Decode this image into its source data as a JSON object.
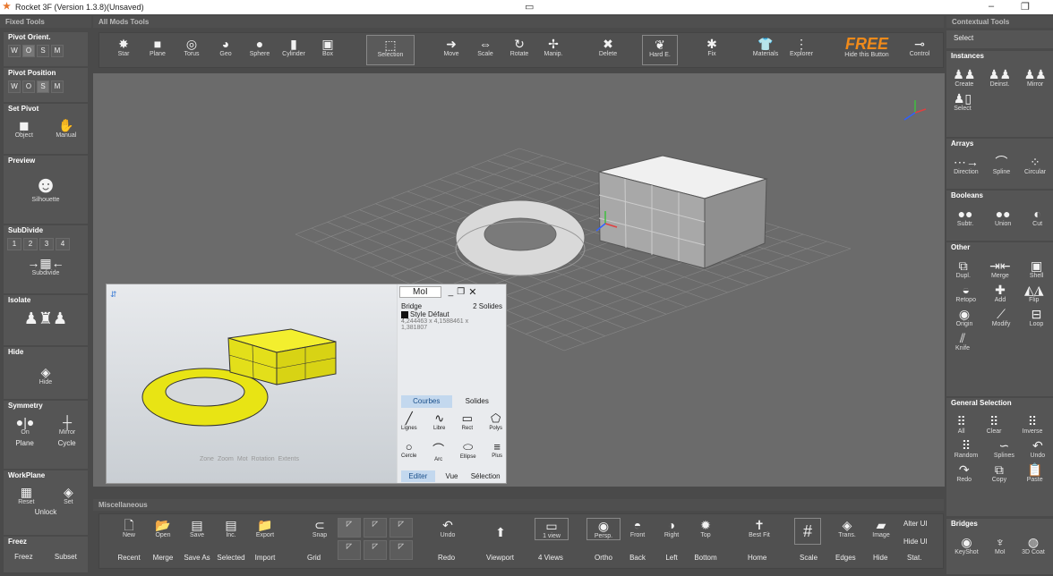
{
  "window": {
    "title": "Rocket 3F (Version 1.3.8)(Unsaved)"
  },
  "sections": {
    "fixed_tools": "Fixed Tools",
    "all_mods_tools": "All Mods Tools",
    "contextual_tools": "Contextual Tools",
    "miscellaneous": "Miscellaneous"
  },
  "left": {
    "pivot_orient": {
      "title": "Pivot Orient.",
      "opts": [
        "W",
        "O",
        "S",
        "M"
      ]
    },
    "pivot_position": {
      "title": "Pivot Position",
      "opts": [
        "W",
        "O",
        "S",
        "M"
      ]
    },
    "set_pivot": {
      "title": "Set Pivot",
      "object": "Object",
      "manual": "Manual"
    },
    "preview": {
      "title": "Preview",
      "silhouette": "Silhouette"
    },
    "subdivide": {
      "title": "SubDivide",
      "levels": [
        "1",
        "2",
        "3",
        "4"
      ],
      "button": "Subdivide"
    },
    "isolate": {
      "title": "Isolate"
    },
    "hide": {
      "title": "Hide",
      "button": "Hide"
    },
    "symmetry": {
      "title": "Symmetry",
      "on": "On",
      "mirror": "Mirror",
      "plane": "Plane",
      "cycle": "Cycle"
    },
    "workplane": {
      "title": "WorkPlane",
      "reset": "Reset",
      "set": "Set",
      "unlock": "Unlock"
    },
    "freez": {
      "title": "Freez",
      "freez": "Freez",
      "subset": "Subset"
    }
  },
  "top_tools": {
    "create": [
      "Star",
      "Plane",
      "Torus",
      "Geo",
      "Sphere",
      "Cylinder",
      "Box"
    ],
    "selection": "Selection",
    "transform": [
      "Move",
      "Scale",
      "Rotate",
      "Manip."
    ],
    "delete": "Delete",
    "hard_e": "Hard E.",
    "fix": "Fix",
    "materials": "Materials",
    "explorer": "Explorer",
    "free_badge": "FREE",
    "hide_btn": "Hide this Button",
    "control": "Control"
  },
  "right": {
    "select_top": "Select",
    "instances": {
      "title": "Instances",
      "items": [
        "Create",
        "Deinst.",
        "Mirror"
      ],
      "select": "Select"
    },
    "arrays": {
      "title": "Arrays",
      "items": [
        "Direction",
        "Spline",
        "Circular"
      ]
    },
    "booleans": {
      "title": "Booleans",
      "items": [
        "Subtr.",
        "Union",
        "Cut"
      ]
    },
    "other": {
      "title": "Other",
      "row1": [
        "Dupl.",
        "Merge",
        "Shell"
      ],
      "row2": [
        "Retopo",
        "Add",
        "Flip"
      ],
      "row3": [
        "Origin",
        "Modify",
        "Loop"
      ],
      "knife": "Knife"
    },
    "general_selection": {
      "title": "General Selection",
      "row1": [
        "All",
        "Clear",
        "Inverse"
      ],
      "row2": [
        "Random",
        "Splines",
        "Undo"
      ],
      "row3": [
        "Redo",
        "Copy",
        "Paste"
      ]
    },
    "bridges": {
      "title": "Bridges",
      "items": [
        "KeyShot",
        "MoI",
        "3D Coat"
      ]
    }
  },
  "bottom": {
    "file_top": [
      "New",
      "Open",
      "Save",
      "Inc.",
      "Export"
    ],
    "file_bottom": [
      "Recent",
      "Merge",
      "Save As",
      "Selected",
      "Import"
    ],
    "snap": "Snap",
    "grid": "Grid",
    "undo": "Undo",
    "redo": "Redo",
    "viewport": "Viewport",
    "one_view": "1 view",
    "four_views": "4 Views",
    "views_top": [
      "Persp.",
      "Front",
      "Right",
      "Top"
    ],
    "views_bottom": [
      "Ortho",
      "Back",
      "Left",
      "Bottom"
    ],
    "best_fit": "Best Fit",
    "home": "Home",
    "scale": "Scale",
    "trans": "Trans.",
    "image": "Image",
    "edges": "Edges",
    "hide": "Hide",
    "alter_ui": "Alter UI",
    "hide_ui": "Hide UI",
    "stat": "Stat."
  },
  "moi": {
    "title": "MoI",
    "object_type": "Bridge",
    "object_count": "2 Solides",
    "style": "Style Défaut",
    "dims1": "4,244463 x 4,1588461 x",
    "dims2": "1,381807",
    "tabs": [
      "Courbes",
      "Solides"
    ],
    "tools_row1": [
      "Lignes",
      "Libre",
      "Rect",
      "Polys"
    ],
    "tools_row2": [
      "Cercle",
      "Arc",
      "Ellipse",
      "Plus"
    ],
    "bottom_tabs": [
      "Editer",
      "Vue",
      "Sélection"
    ],
    "view_controls": [
      "Zone",
      "Zoom",
      "Mot",
      "Rotation",
      "Extents"
    ]
  }
}
